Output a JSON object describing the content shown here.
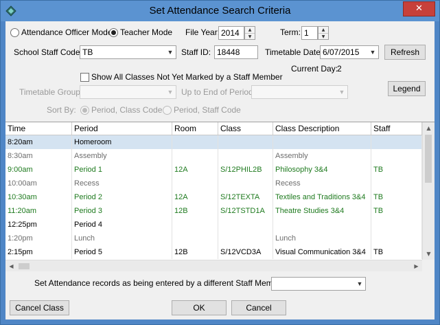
{
  "window": {
    "title": "Set Attendance Search Criteria",
    "close_glyph": "✕"
  },
  "mode": {
    "attendance_officer_label": "Attendance Officer Mode",
    "teacher_label": "Teacher Mode",
    "selected": "teacher"
  },
  "file_year": {
    "label": "File Year:",
    "value": "2014"
  },
  "term": {
    "label": "Term:",
    "value": "1"
  },
  "school_staff_code": {
    "label": "School Staff Code:",
    "value": "TB"
  },
  "staff_id": {
    "label": "Staff ID:",
    "value": "18448"
  },
  "timetable_date": {
    "label": "Timetable Date:",
    "value": "6/07/2015"
  },
  "refresh_label": "Refresh",
  "current_day": {
    "label": "Current Day:",
    "value": "2"
  },
  "show_all_classes": {
    "label": "Show All Classes Not Yet Marked by a Staff Member",
    "checked": false
  },
  "legend_label": "Legend",
  "timetable_group": {
    "label": "Timetable Group:",
    "value": ""
  },
  "up_to_end_of_period": {
    "label": "Up to End of Period:",
    "value": ""
  },
  "sort_by": {
    "label": "Sort By:",
    "options": [
      "Period, Class Code",
      "Period, Staff Code"
    ],
    "selected": "Period, Class Code"
  },
  "table": {
    "columns": [
      "Time",
      "Period",
      "Room",
      "Class",
      "Class Description",
      "Staff"
    ],
    "rows": [
      {
        "time": "8:20am",
        "period": "Homeroom",
        "room": "",
        "class": "",
        "description": "",
        "staff": "",
        "color": "#000000",
        "selected": true
      },
      {
        "time": "8:30am",
        "period": "Assembly",
        "room": "",
        "class": "",
        "description": "Assembly",
        "staff": "",
        "color": "#6d6d6d",
        "selected": false
      },
      {
        "time": "9:00am",
        "period": "Period 1",
        "room": "12A",
        "class": "S/12PHIL2B",
        "description": "Philosophy 3&4",
        "staff": "TB",
        "color": "#1e7a1e",
        "selected": false
      },
      {
        "time": "10:00am",
        "period": "Recess",
        "room": "",
        "class": "",
        "description": "Recess",
        "staff": "",
        "color": "#6d6d6d",
        "selected": false
      },
      {
        "time": "10:30am",
        "period": "Period 2",
        "room": "12A",
        "class": "S/12TEXTA",
        "description": "Textiles and Traditions 3&4",
        "staff": "TB",
        "color": "#1e7a1e",
        "selected": false
      },
      {
        "time": "11:20am",
        "period": "Period 3",
        "room": "12B",
        "class": "S/12TSTD1A",
        "description": "Theatre Studies 3&4",
        "staff": "TB",
        "color": "#1e7a1e",
        "selected": false
      },
      {
        "time": "12:25pm",
        "period": "Period 4",
        "room": "",
        "class": "",
        "description": "",
        "staff": "",
        "color": "#000000",
        "selected": false
      },
      {
        "time": "1:20pm",
        "period": "Lunch",
        "room": "",
        "class": "",
        "description": "Lunch",
        "staff": "",
        "color": "#6d6d6d",
        "selected": false
      },
      {
        "time": "2:15pm",
        "period": "Period 5",
        "room": "12B",
        "class": "S/12VCD3A",
        "description": "Visual Communication 3&4",
        "staff": "TB",
        "color": "#000000",
        "selected": false
      }
    ]
  },
  "different_staff": {
    "label": "Set Attendance records as being entered by a different Staff Member:",
    "value": ""
  },
  "buttons": {
    "cancel_class": "Cancel Class",
    "ok": "OK",
    "cancel": "Cancel"
  },
  "icons": {
    "dropdown": "chevron-down-icon",
    "spin_up": "spin-up-icon",
    "spin_down": "spin-down-icon",
    "scroll_up": "arrow-up-icon",
    "scroll_down": "arrow-down-icon",
    "scroll_left": "arrow-left-icon",
    "scroll_right": "arrow-right-icon",
    "app": "app-diamond-icon"
  },
  "colors": {
    "titlebar": "#5b93d1",
    "close": "#c7403a",
    "selected_row": "#d4e3f1",
    "scheduled_text": "#1e7a1e",
    "break_text": "#6d6d6d"
  }
}
